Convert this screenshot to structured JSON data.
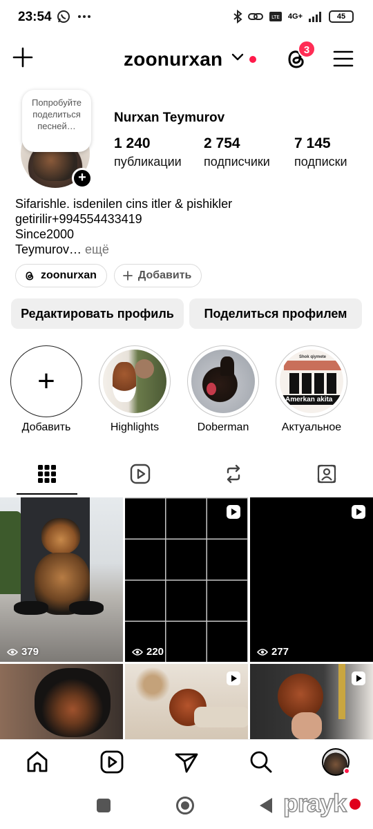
{
  "status_bar": {
    "time": "23:54",
    "battery": "45",
    "network": "4G+"
  },
  "header": {
    "username": "zoonurxan",
    "threads_badge": "3"
  },
  "profile": {
    "note": "Попробуйте поделиться песней…",
    "name": "Nurxan Teymurov",
    "stats": {
      "posts_value": "1 240",
      "posts_label": "публикации",
      "followers_value": "2 754",
      "followers_label": "подписчики",
      "following_value": "7 145",
      "following_label": "подписки"
    },
    "bio": {
      "line1": "Sifarishle. isdenilen cins itler & pishikler",
      "line2": "getirilir+994554433419",
      "line3": "Since2000",
      "line4": "Teymurov…",
      "more": " ещё"
    },
    "chips": {
      "threads_handle": "zoonurxan",
      "add_label": "Добавить"
    },
    "buttons": {
      "edit_profile": "Редактировать профиль",
      "share_profile": "Поделиться профилем"
    }
  },
  "highlights": [
    {
      "label": "Добавить"
    },
    {
      "label": "Highlights"
    },
    {
      "label": "Doberman"
    },
    {
      "label": "Актуальное"
    }
  ],
  "highlight_text": {
    "actual_caption": "Amerkan akita",
    "actual_top": "Shok qiymete"
  },
  "grid": {
    "posts": [
      {
        "views": "379"
      },
      {
        "views": "220"
      },
      {
        "views": "277"
      }
    ]
  },
  "watermark": "prayk"
}
